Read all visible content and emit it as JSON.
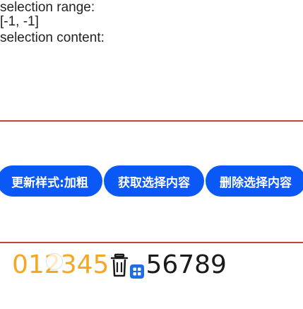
{
  "selection": {
    "range_label": "selection range:",
    "range_value": "[-1, -1]",
    "content_label": "selection content:"
  },
  "buttons": {
    "update_style": "更新样式:加粗",
    "get_selection": "获取选择内容",
    "delete_selection": "删除选择内容"
  },
  "editor": {
    "text_highlighted": "012345",
    "text_plain": "56789",
    "highlight_color": "#f5a623",
    "icons": [
      "trash-icon",
      "grid-icon"
    ]
  },
  "colors": {
    "accent": "#0a59f7",
    "divider": "#c2453a"
  }
}
